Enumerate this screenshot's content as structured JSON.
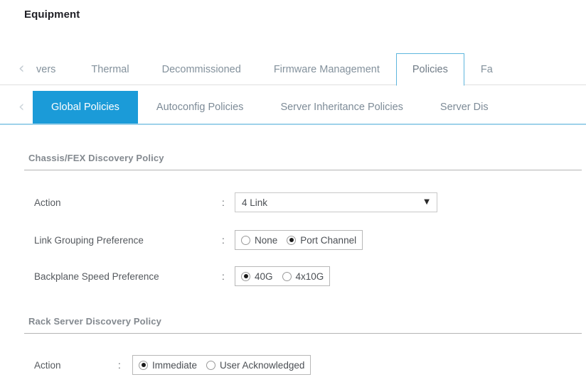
{
  "header": {
    "title": "Equipment"
  },
  "tabbar": {
    "scroll_left_icon": "chevron-left-icon",
    "tabs": [
      {
        "label": "vers",
        "active": false
      },
      {
        "label": "Thermal",
        "active": false
      },
      {
        "label": "Decommissioned",
        "active": false
      },
      {
        "label": "Firmware Management",
        "active": false
      },
      {
        "label": "Policies",
        "active": true
      },
      {
        "label": "Fa",
        "active": false
      }
    ]
  },
  "subtabbar": {
    "scroll_left_icon": "chevron-left-icon",
    "tabs": [
      {
        "label": "Global Policies",
        "active": true
      },
      {
        "label": "Autoconfig Policies",
        "active": false
      },
      {
        "label": "Server Inheritance Policies",
        "active": false
      },
      {
        "label": "Server Dis",
        "active": false
      }
    ]
  },
  "sections": [
    {
      "title": "Chassis/FEX Discovery Policy",
      "action": {
        "label": "Action",
        "colon": ":",
        "value": "4 Link",
        "arrow_icon": "chevron-down-icon"
      },
      "link_grouping": {
        "label": "Link Grouping Preference",
        "colon": ":",
        "options": [
          {
            "label": "None",
            "checked": false
          },
          {
            "label": "Port Channel",
            "checked": true
          }
        ]
      },
      "backplane_speed": {
        "label": "Backplane Speed Preference",
        "colon": ":",
        "options": [
          {
            "label": "40G",
            "checked": true
          },
          {
            "label": "4x10G",
            "checked": false
          }
        ]
      }
    },
    {
      "title": "Rack Server Discovery Policy",
      "action": {
        "label": "Action",
        "colon": ":",
        "options": [
          {
            "label": "Immediate",
            "checked": true
          },
          {
            "label": "User Acknowledged",
            "checked": false
          }
        ]
      }
    }
  ],
  "colors": {
    "accent_blue": "#1b9bd8",
    "tab_border_blue": "#5eb6dd",
    "underline_blue": "#9ed2ea",
    "text_gray": "#83919c",
    "rule_gray": "#b4b4b4"
  }
}
